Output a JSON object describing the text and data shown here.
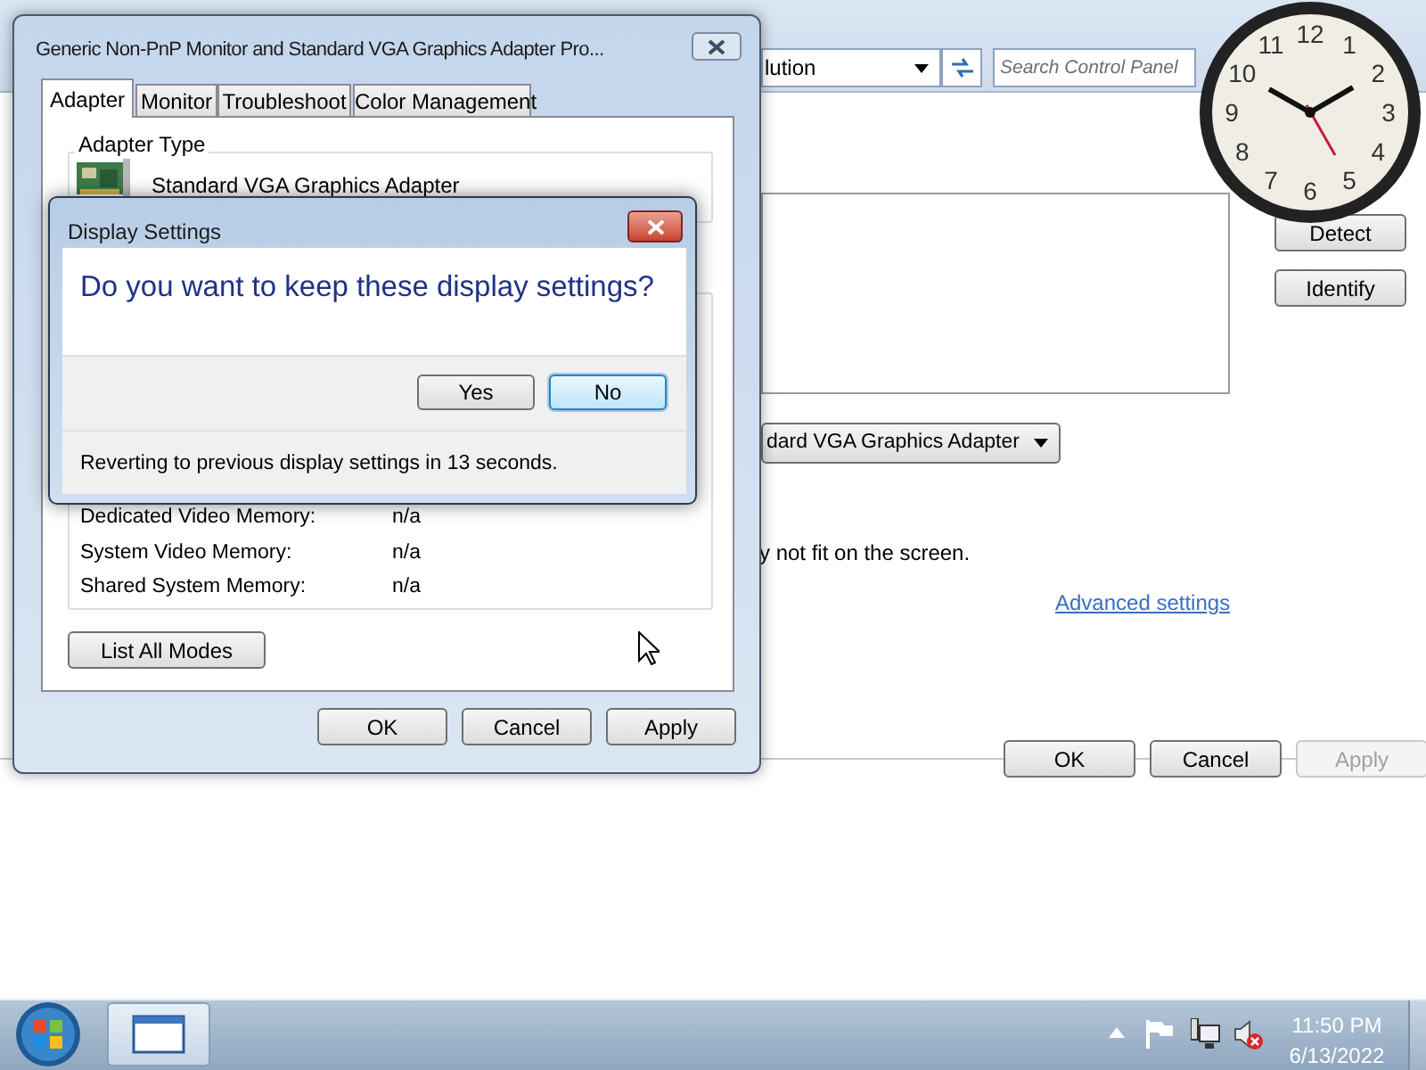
{
  "background_window": {
    "address_crumb": "lution",
    "search": {
      "placeholder": "Search Control Panel"
    },
    "side_buttons": [
      {
        "label": "Detect"
      },
      {
        "label": "Identify"
      }
    ],
    "display_dropdown": "dard VGA Graphics Adapter",
    "note": "y not fit on the screen.",
    "link": "Advanced settings",
    "buttons": [
      {
        "label": "OK",
        "disabled": false
      },
      {
        "label": "Cancel",
        "disabled": false
      },
      {
        "label": "Apply",
        "disabled": true
      }
    ]
  },
  "clock": {
    "numerals": [
      "11",
      "12",
      "1",
      "10",
      "2",
      "9",
      "3",
      "8",
      "4",
      "7",
      "5",
      "6"
    ]
  },
  "properties_window": {
    "title": "Generic Non-PnP Monitor and Standard VGA Graphics Adapter Pro...",
    "tabs": [
      {
        "label": "Adapter",
        "selected": true
      },
      {
        "label": "Monitor",
        "selected": false
      },
      {
        "label": "Troubleshoot",
        "selected": false
      },
      {
        "label": "Color Management",
        "selected": false
      }
    ],
    "adapter_type": {
      "heading": "Adapter Type",
      "name": "Standard VGA Graphics Adapter"
    },
    "memory": [
      {
        "label": "Dedicated Video Memory:",
        "value": "n/a"
      },
      {
        "label": "System Video Memory:",
        "value": "n/a"
      },
      {
        "label": "Shared System Memory:",
        "value": "n/a"
      }
    ],
    "list_modes_button": "List All Modes",
    "buttons": [
      {
        "label": "OK",
        "disabled": false
      },
      {
        "label": "Cancel",
        "disabled": false
      },
      {
        "label": "Apply",
        "disabled": false
      }
    ]
  },
  "dialog": {
    "title": "Display Settings",
    "question": "Do you want to keep these display settings?",
    "buttons": [
      {
        "label": "Yes",
        "focused": false
      },
      {
        "label": "No",
        "focused": true
      }
    ],
    "countdown": "Reverting to previous display settings in 13 seconds."
  },
  "taskbar": {
    "time": "11:50 PM",
    "date": "6/13/2022"
  }
}
